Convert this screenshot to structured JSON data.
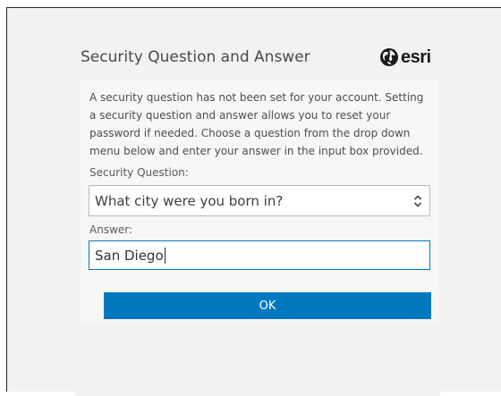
{
  "dialog": {
    "title": "Security Question and Answer",
    "logo_text": "esri",
    "description": "A security question has not been set for your account. Setting a security question and answer allows you to reset your password if needed. Choose a question from the drop down menu below and enter your answer in the input box provided.",
    "question_label": "Security Question:",
    "question_selected": "What city were you born in?",
    "answer_label": "Answer:",
    "answer_value": "San Diego",
    "ok_label": "OK"
  },
  "icons": {
    "logo": "globe-icon",
    "select": "up-down-chevron-icon"
  },
  "colors": {
    "accent": "#0079c1",
    "panel_bg": "#f2f2f2",
    "card_bg": "#f7f7f7"
  }
}
